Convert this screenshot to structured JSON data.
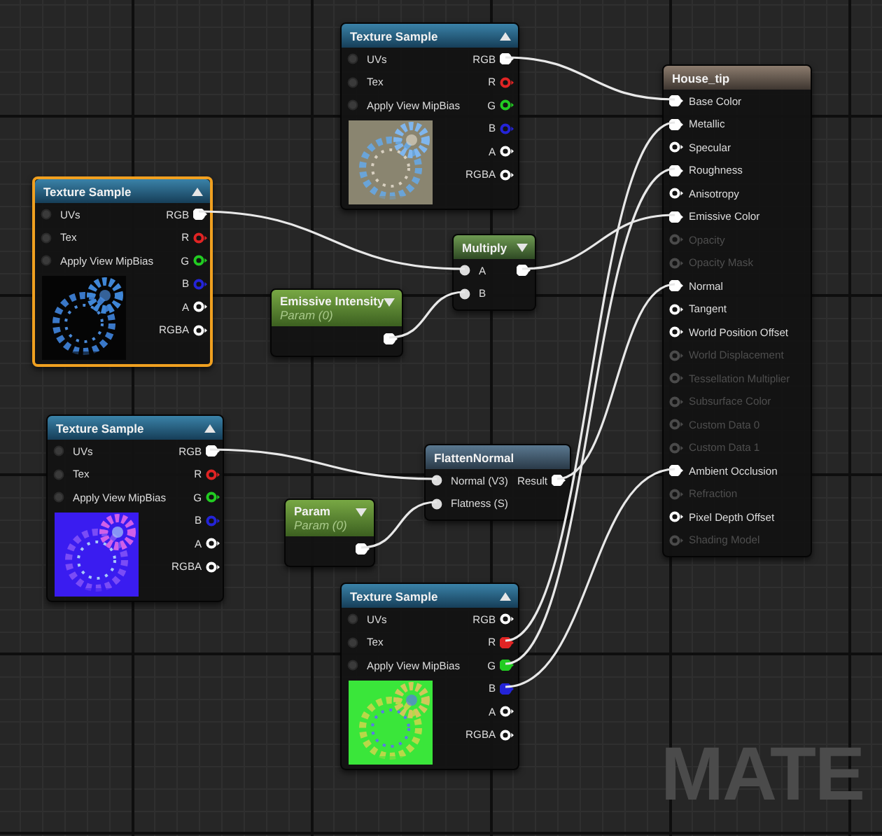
{
  "nodes": [
    {
      "kind": "texture",
      "title": "Texture Sample",
      "selected": false,
      "inputs": [
        {
          "label": "UVs",
          "connected": false
        },
        {
          "label": "Tex",
          "connected": false
        },
        {
          "label": "Apply View MipBias",
          "connected": false
        }
      ],
      "outputs": [
        {
          "label": "RGB",
          "color": "#ffffff",
          "connected": true
        },
        {
          "label": "R",
          "color": "#e02424",
          "connected": false
        },
        {
          "label": "G",
          "color": "#22cc22",
          "connected": false
        },
        {
          "label": "B",
          "color": "#2424d8",
          "connected": false
        },
        {
          "label": "A",
          "color": "#ffffff",
          "connected": false
        },
        {
          "label": "RGBA",
          "color": "#ffffff",
          "connected": false
        }
      ]
    },
    {
      "kind": "result",
      "title": "House_tip",
      "selected": false,
      "inputs": [
        {
          "label": "Base Color",
          "connected": true,
          "disabled": false
        },
        {
          "label": "Metallic",
          "connected": true,
          "disabled": false
        },
        {
          "label": "Specular",
          "connected": false,
          "disabled": false
        },
        {
          "label": "Roughness",
          "connected": true,
          "disabled": false
        },
        {
          "label": "Anisotropy",
          "connected": false,
          "disabled": false
        },
        {
          "label": "Emissive Color",
          "connected": true,
          "disabled": false
        },
        {
          "label": "Opacity",
          "connected": false,
          "disabled": true
        },
        {
          "label": "Opacity Mask",
          "connected": false,
          "disabled": true
        },
        {
          "label": "Normal",
          "connected": true,
          "disabled": false
        },
        {
          "label": "Tangent",
          "connected": false,
          "disabled": false
        },
        {
          "label": "World Position Offset",
          "connected": false,
          "disabled": false
        },
        {
          "label": "World Displacement",
          "connected": false,
          "disabled": true
        },
        {
          "label": "Tessellation Multiplier",
          "connected": false,
          "disabled": true
        },
        {
          "label": "Subsurface Color",
          "connected": false,
          "disabled": true
        },
        {
          "label": "Custom Data 0",
          "connected": false,
          "disabled": true
        },
        {
          "label": "Custom Data 1",
          "connected": false,
          "disabled": true
        },
        {
          "label": "Ambient Occlusion",
          "connected": true,
          "disabled": false
        },
        {
          "label": "Refraction",
          "connected": false,
          "disabled": true
        },
        {
          "label": "Pixel Depth Offset",
          "connected": false,
          "disabled": false
        },
        {
          "label": "Shading Model",
          "connected": false,
          "disabled": true
        }
      ]
    },
    {
      "kind": "texture",
      "title": "Texture Sample",
      "selected": true,
      "inputs": [
        {
          "label": "UVs",
          "connected": false
        },
        {
          "label": "Tex",
          "connected": false
        },
        {
          "label": "Apply View MipBias",
          "connected": false
        }
      ],
      "outputs": [
        {
          "label": "RGB",
          "color": "#ffffff",
          "connected": true
        },
        {
          "label": "R",
          "color": "#e02424",
          "connected": false
        },
        {
          "label": "G",
          "color": "#22cc22",
          "connected": false
        },
        {
          "label": "B",
          "color": "#2424d8",
          "connected": false
        },
        {
          "label": "A",
          "color": "#ffffff",
          "connected": false
        },
        {
          "label": "RGBA",
          "color": "#ffffff",
          "connected": false
        }
      ]
    },
    {
      "kind": "math",
      "title": "Multiply",
      "selected": false,
      "inputs": [
        {
          "label": "A",
          "connected": true
        },
        {
          "label": "B",
          "connected": true
        }
      ],
      "outputs": [
        {
          "connected": true
        }
      ]
    },
    {
      "kind": "param",
      "title": "Emissive Intensity",
      "subtitle": "Param (0)",
      "selected": false,
      "outputs": [
        {
          "connected": true
        }
      ]
    },
    {
      "kind": "texture",
      "title": "Texture Sample",
      "selected": false,
      "inputs": [
        {
          "label": "UVs",
          "connected": false
        },
        {
          "label": "Tex",
          "connected": false
        },
        {
          "label": "Apply View MipBias",
          "connected": false
        }
      ],
      "outputs": [
        {
          "label": "RGB",
          "color": "#ffffff",
          "connected": true
        },
        {
          "label": "R",
          "color": "#e02424",
          "connected": false
        },
        {
          "label": "G",
          "color": "#22cc22",
          "connected": false
        },
        {
          "label": "B",
          "color": "#2424d8",
          "connected": false
        },
        {
          "label": "A",
          "color": "#ffffff",
          "connected": false
        },
        {
          "label": "RGBA",
          "color": "#ffffff",
          "connected": false
        }
      ]
    },
    {
      "kind": "function",
      "title": "FlattenNormal",
      "selected": false,
      "inputs": [
        {
          "label": "Normal (V3)",
          "connected": true
        },
        {
          "label": "Flatness (S)",
          "connected": true
        }
      ],
      "outputs": [
        {
          "label": "Result",
          "connected": true
        }
      ]
    },
    {
      "kind": "param",
      "title": "Param",
      "subtitle": "Param (0)",
      "selected": false,
      "outputs": [
        {
          "connected": true
        }
      ]
    },
    {
      "kind": "texture",
      "title": "Texture Sample",
      "selected": false,
      "inputs": [
        {
          "label": "UVs",
          "connected": false
        },
        {
          "label": "Tex",
          "connected": false
        },
        {
          "label": "Apply View MipBias",
          "connected": false
        }
      ],
      "outputs": [
        {
          "label": "RGB",
          "color": "#ffffff",
          "connected": false
        },
        {
          "label": "R",
          "color": "#e02424",
          "connected": true
        },
        {
          "label": "G",
          "color": "#22cc22",
          "connected": true
        },
        {
          "label": "B",
          "color": "#2424d8",
          "connected": true
        },
        {
          "label": "A",
          "color": "#ffffff",
          "connected": false
        },
        {
          "label": "RGBA",
          "color": "#ffffff",
          "connected": false
        }
      ]
    }
  ],
  "watermark": "MATE"
}
